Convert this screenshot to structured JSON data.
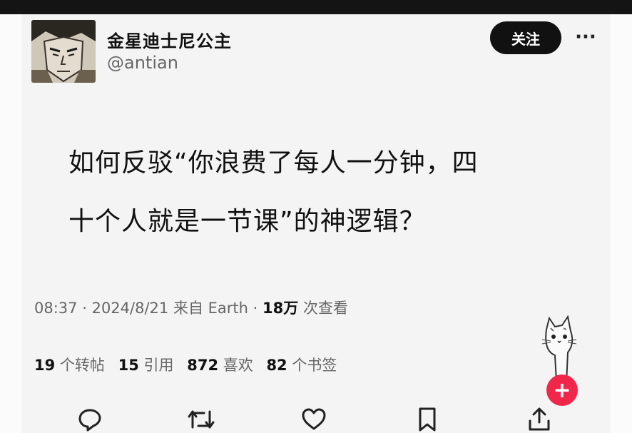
{
  "user": {
    "display_name": "金星迪士尼公主",
    "handle": "@antian"
  },
  "header": {
    "follow_label": "关注",
    "more_icon": "more-icon"
  },
  "post": {
    "line1": "如何反驳“你浪费了每人一分钟，四",
    "line2": "十个人就是一节课”的神逻辑？"
  },
  "meta": {
    "time": "08:37",
    "date": "2024/8/21",
    "source": "来自 Earth",
    "views_value": "18万",
    "views_label": "次查看"
  },
  "stats": {
    "reposts_value": "19",
    "reposts_label": "个转帖",
    "quotes_value": "15",
    "quotes_label": "引用",
    "likes_value": "872",
    "likes_label": "喜欢",
    "bookmarks_value": "82",
    "bookmarks_label": "个书签"
  },
  "actions": [
    "reply-icon",
    "retweet-icon",
    "like-icon",
    "bookmark-icon",
    "share-icon"
  ],
  "colors": {
    "follow_bg": "#111111",
    "plus_fab": "#f0264b"
  }
}
